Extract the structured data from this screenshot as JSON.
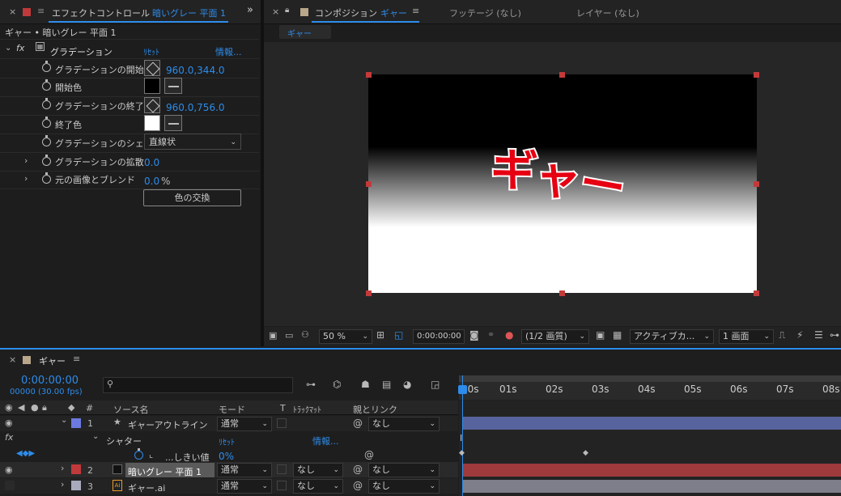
{
  "effect_panel": {
    "tab_label": "エフェクトコントロール",
    "tab_target": "暗いグレー 平面 1",
    "breadcrumb": "ギャー • 暗いグレー 平面 1",
    "effect_name": "グラデーション",
    "reset": "ﾘｾｯﾄ",
    "info": "情報...",
    "props": {
      "start": {
        "label": "グラデーションの開始",
        "value": "960.0,344.0"
      },
      "start_color": {
        "label": "開始色",
        "color": "#000000"
      },
      "end": {
        "label": "グラデーションの終了",
        "value": "960.0,756.0"
      },
      "end_color": {
        "label": "終了色",
        "color": "#ffffff"
      },
      "shape": {
        "label": "グラデーションのシェ",
        "value": "直線状"
      },
      "scatter": {
        "label": "グラデーションの拡散",
        "value": "0.0"
      },
      "blend": {
        "label": "元の画像とブレンド",
        "value": "0.0",
        "unit": "%"
      },
      "swap_button": "色の交換"
    }
  },
  "comp_panel": {
    "tab_label": "コンポジション",
    "comp_name": "ギャー",
    "footage_tab": "フッテージ (なし)",
    "layer_tab": "レイヤー (なし)",
    "subtab": "ギャー",
    "canvas_text": "ギャー",
    "toolbar": {
      "zoom": "50 %",
      "timecode": "0:00:00:00",
      "resolution": "(1/2 画質)",
      "camera": "アクティブカ...",
      "views": "1 画面"
    }
  },
  "timeline": {
    "tab_label": "ギャー",
    "timecode": "0:00:00:00",
    "frames": "00000 (30.00 fps)",
    "search_placeholder": "",
    "columns": {
      "num": "#",
      "source": "ソース名",
      "mode": "モード",
      "t": "T",
      "trackmatte": "ﾄﾗｯｸﾏｯﾄ",
      "parent": "親とリンク"
    },
    "ruler": [
      "00s",
      "01s",
      "02s",
      "03s",
      "04s",
      "05s",
      "06s",
      "07s",
      "08s"
    ],
    "layers": [
      {
        "num": "1",
        "name": "ギャーアウトライン",
        "mode": "通常",
        "matte": "",
        "parent": "なし",
        "color": "#6c7ae0",
        "bar": "#57639c"
      },
      {
        "num": "2",
        "name": "暗いグレー 平面 1",
        "mode": "通常",
        "matte": "なし",
        "parent": "なし",
        "color": "#c0393b",
        "bar": "#9e3a3c"
      },
      {
        "num": "3",
        "name": "ギャー.ai",
        "mode": "通常",
        "matte": "なし",
        "parent": "なし",
        "color": "#a9aabd",
        "bar": "#7d7e8a"
      }
    ],
    "shatter": {
      "label": "シャター",
      "reset": "ﾘｾｯﾄ",
      "info": "情報..."
    },
    "threshold": {
      "label": "...しきい値",
      "value": "0%"
    }
  }
}
